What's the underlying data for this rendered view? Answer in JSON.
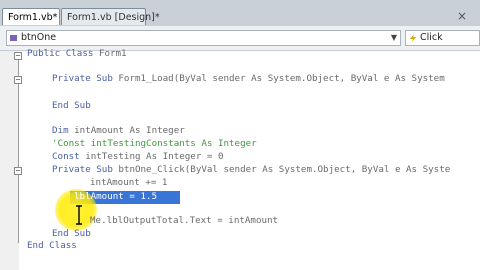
{
  "tabs": [
    {
      "label": "Form1.vb*"
    },
    {
      "label": "Form1.vb [Design]*"
    }
  ],
  "close_glyph": "×",
  "dropdowns": {
    "object": "btnOne",
    "event": "Click"
  },
  "code": {
    "line1": {
      "kw": "Public Class ",
      "rest": "Form1"
    },
    "line2": {
      "kw": "Private Sub ",
      "rest": "Form1_Load(ByVal sender As System.Object, ByVal e As System"
    },
    "line3": {
      "kw": "End Sub",
      "rest": ""
    },
    "line4": {
      "kw": "Dim ",
      "rest": "intAmount As Integer"
    },
    "line5": {
      "comment": "'Const intTestingConstants As Integer"
    },
    "line6": {
      "kw": "Const ",
      "rest": "intTesting As Integer = 0"
    },
    "line7": {
      "kw": "Private Sub ",
      "rest": "btnOne_Click(ByVal sender As System.Object, ByVal e As Syste"
    },
    "line8": {
      "text": "intAmount += 1"
    },
    "line9": {
      "text": "lblAmount = 1.5"
    },
    "line10": {
      "text": "Me.lblOutputTotal.Text = intAmount"
    },
    "line11": {
      "kw": "End Sub",
      "rest": ""
    },
    "line12": {
      "kw": "End Class",
      "rest": ""
    }
  },
  "colors": {
    "keyword": "#4a5fa8",
    "comment": "#3d9a3d",
    "selection": "#3875d7",
    "cursor_highlight": "#ffeb00"
  },
  "icons": {
    "object_dropdown": "class-member-icon",
    "event_dropdown": "event-lightning-icon"
  }
}
